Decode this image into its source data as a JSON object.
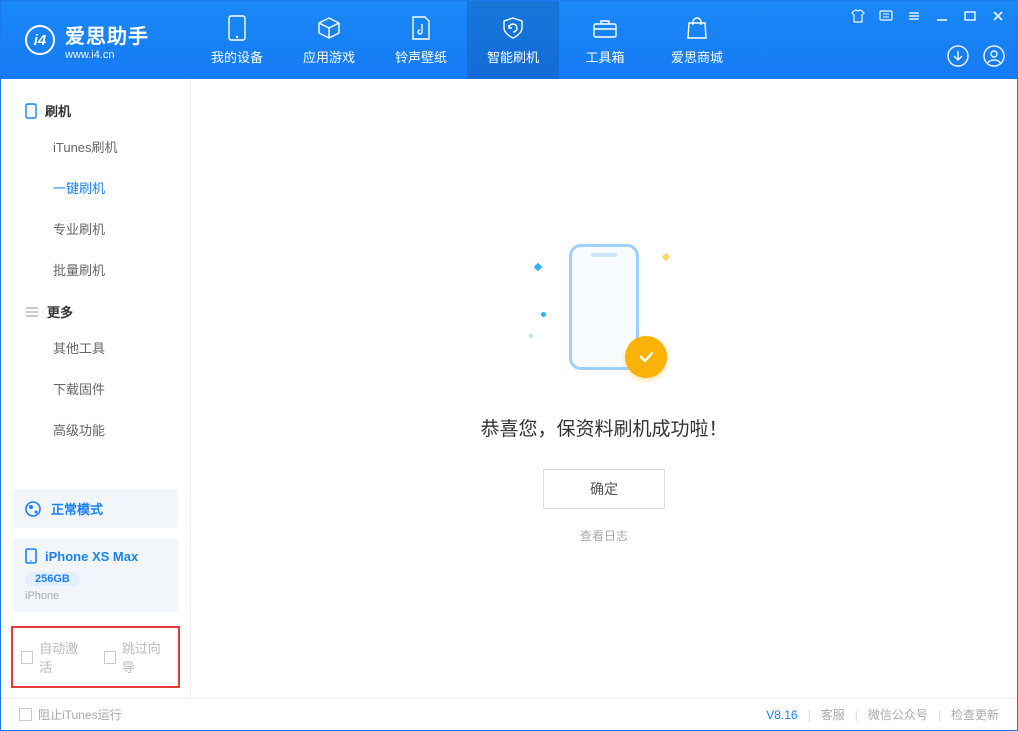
{
  "brand": {
    "name": "爱思助手",
    "url": "www.i4.cn"
  },
  "tabs": [
    {
      "label": "我的设备",
      "icon": "device"
    },
    {
      "label": "应用游戏",
      "icon": "cube"
    },
    {
      "label": "铃声壁纸",
      "icon": "music"
    },
    {
      "label": "智能刷机",
      "icon": "refresh",
      "active": true
    },
    {
      "label": "工具箱",
      "icon": "toolbox"
    },
    {
      "label": "爱思商城",
      "icon": "bag"
    }
  ],
  "sidebar": {
    "group_flash": "刷机",
    "items_flash": [
      "iTunes刷机",
      "一键刷机",
      "专业刷机",
      "批量刷机"
    ],
    "active_flash_index": 1,
    "group_more": "更多",
    "items_more": [
      "其他工具",
      "下载固件",
      "高级功能"
    ],
    "mode": "正常模式",
    "device": {
      "name": "iPhone XS Max",
      "storage": "256GB",
      "type": "iPhone"
    },
    "bottom_checks": [
      "自动激活",
      "跳过向导"
    ]
  },
  "main": {
    "success_msg": "恭喜您，保资料刷机成功啦！",
    "ok_btn": "确定",
    "log_link": "查看日志"
  },
  "footer": {
    "block_itunes": "阻止iTunes运行",
    "version": "V8.16",
    "links": [
      "客服",
      "微信公众号",
      "检查更新"
    ]
  }
}
